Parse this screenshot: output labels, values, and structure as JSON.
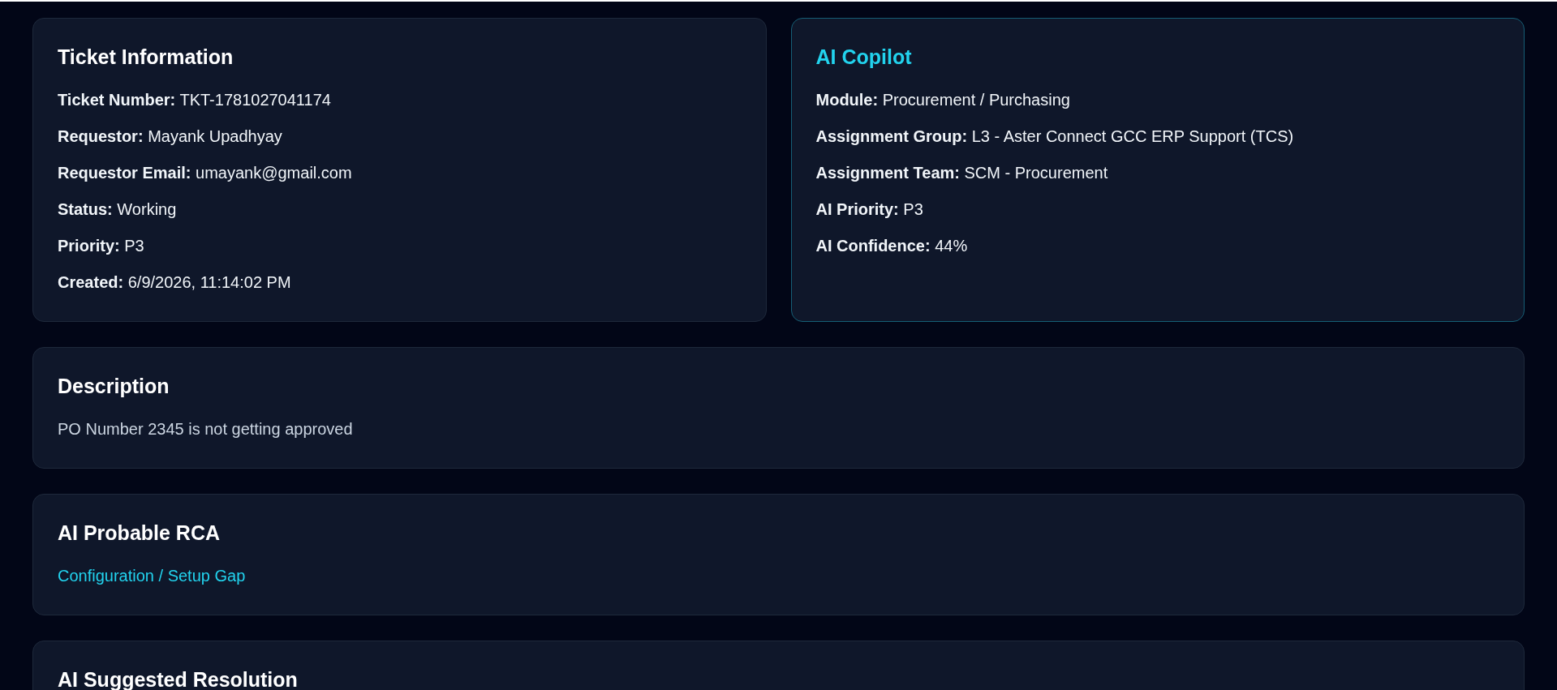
{
  "ticket_information": {
    "title": "Ticket Information",
    "fields": [
      {
        "label": "Ticket Number:",
        "value": "TKT-1781027041174"
      },
      {
        "label": "Requestor:",
        "value": "Mayank Upadhyay"
      },
      {
        "label": "Requestor Email:",
        "value": "umayank@gmail.com"
      },
      {
        "label": "Status:",
        "value": "Working"
      },
      {
        "label": "Priority:",
        "value": "P3"
      },
      {
        "label": "Created:",
        "value": "6/9/2026, 11:14:02 PM"
      }
    ]
  },
  "ai_copilot": {
    "title": "AI Copilot",
    "fields": [
      {
        "label": "Module:",
        "value": "Procurement / Purchasing"
      },
      {
        "label": "Assignment Group:",
        "value": "L3 - Aster Connect GCC ERP Support (TCS)"
      },
      {
        "label": "Assignment Team:",
        "value": "SCM - Procurement"
      },
      {
        "label": "AI Priority:",
        "value": "P3"
      },
      {
        "label": "AI Confidence:",
        "value": "44%"
      }
    ]
  },
  "sections": [
    {
      "kind": "text",
      "title": "Description",
      "body": "PO Number 2345 is not getting approved"
    },
    {
      "kind": "highlight",
      "title": "AI Probable RCA",
      "body": "Configuration / Setup Gap"
    },
    {
      "title": "AI Suggested Resolution"
    }
  ]
}
